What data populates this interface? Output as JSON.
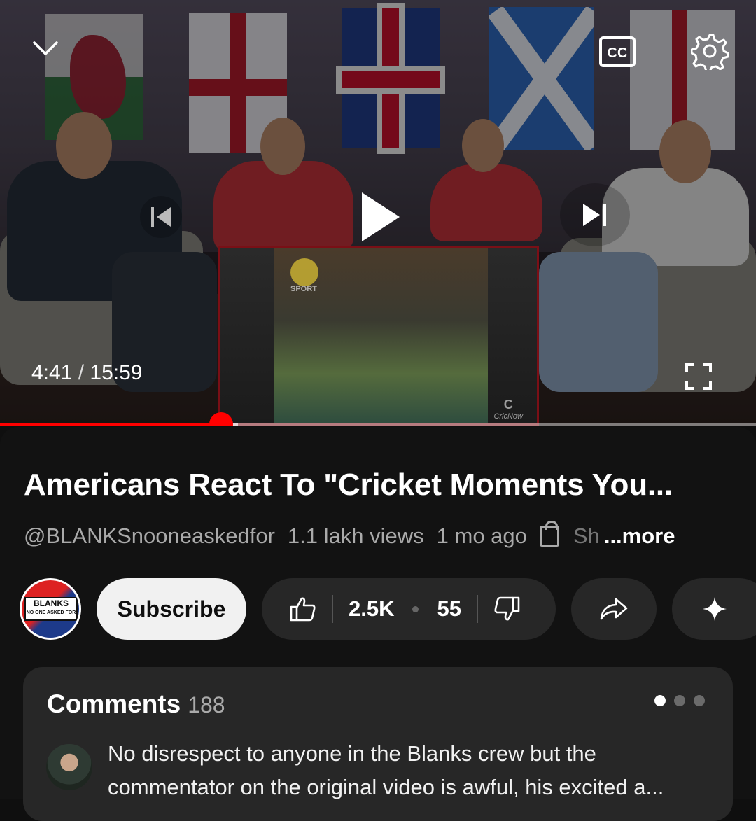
{
  "player": {
    "current_time": "4:41",
    "separator": "/",
    "duration": "15:59",
    "progress": 0.293,
    "buffered": 0.315,
    "inset_overlay": {
      "logo_text": "SPORT",
      "watermark_letter": "C",
      "watermark_text": "CricNow"
    },
    "icons": {
      "collapse": "chevron-down-icon",
      "captions": "closed-captions-icon",
      "settings": "gear-icon",
      "previous": "skip-previous-icon",
      "play": "play-icon",
      "next": "skip-next-icon",
      "fullscreen": "fullscreen-icon"
    },
    "captions_label": "CC"
  },
  "video": {
    "title": "Americans React To \"Cricket Moments You...",
    "channel_handle": "@BLANKSnooneaskedfor",
    "views": "1.1 lakh views",
    "age": "1 mo ago",
    "shop_label": "Sh",
    "more_label": "...more"
  },
  "channel": {
    "avatar_text_1": "BLANKS",
    "avatar_text_2": "NO ONE ASKED FOR",
    "subscribe_label": "Subscribe"
  },
  "actions": {
    "likes": "2.5K",
    "dislikes": "55",
    "share_icon": "share-arrow-icon",
    "remix_icon": "sparkle-icon"
  },
  "comments": {
    "title": "Comments",
    "count": "188",
    "top_comment_line1": "No disrespect to anyone in the Blanks crew but the",
    "top_comment_line2": "commentator on the original video is awful, his excited a..."
  },
  "colors": {
    "accent": "#ff0000",
    "background": "#0f0f0f",
    "surface": "#272727"
  }
}
